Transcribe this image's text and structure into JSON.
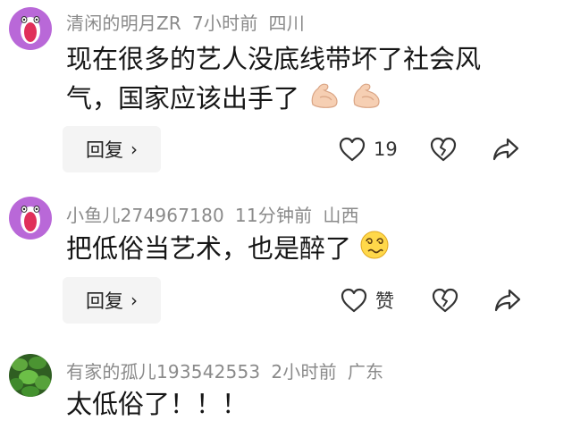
{
  "comments": [
    {
      "username": "清闲的明月ZR",
      "time": "7小时前",
      "location": "四川",
      "text_line1": "现在很多的艺人没底线带坏了社会风",
      "text_line2": "气，国家应该出手了",
      "emojis": [
        "flexed-biceps-emoji",
        "flexed-biceps-emoji"
      ],
      "reply_label": "回复",
      "like_label": "19",
      "avatar": "screaming-face-avatar"
    },
    {
      "username": "小鱼儿274967180",
      "time": "11分钟前",
      "location": "山西",
      "text": "把低俗当艺术，也是醉了",
      "emojis": [
        "dizzy-face-emoji"
      ],
      "reply_label": "回复",
      "like_label": "赞",
      "avatar": "screaming-face-avatar"
    },
    {
      "username": "有家的孤儿193542553",
      "time": "2小时前",
      "location": "广东",
      "text": "太低俗了！！！",
      "avatar": "green-plant-avatar"
    }
  ],
  "colors": {
    "meta": "#8a8a8a",
    "text": "#161616",
    "reply_bg": "#f4f4f4",
    "avatar_purple": "#b968d8",
    "avatar_green": "#3d7a2a"
  }
}
